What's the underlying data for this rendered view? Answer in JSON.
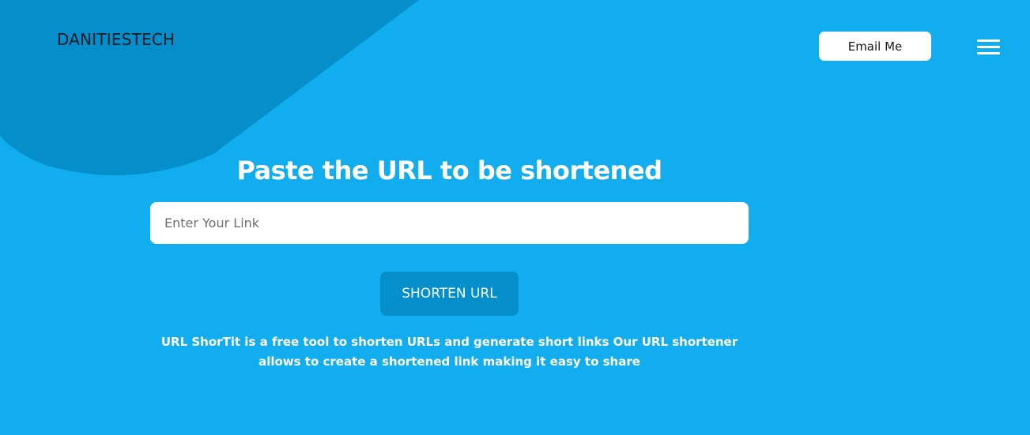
{
  "colors": {
    "background": "#11adef",
    "blob": "#048fcb",
    "button": "#048fcb",
    "text_light": "#ffffff",
    "brand_text": "#0b1a24"
  },
  "header": {
    "brand": "DANITIESTECH",
    "email_button": "Email Me",
    "menu_icon": "hamburger-menu-icon"
  },
  "main": {
    "headline": "Paste the URL to be shortened",
    "input": {
      "placeholder": "Enter Your Link",
      "value": ""
    },
    "submit_button": "SHORTEN URL",
    "description": "URL ShorTit is a free tool to shorten URLs and generate short links Our URL shortener allows to create a shortened link making it easy to share"
  }
}
